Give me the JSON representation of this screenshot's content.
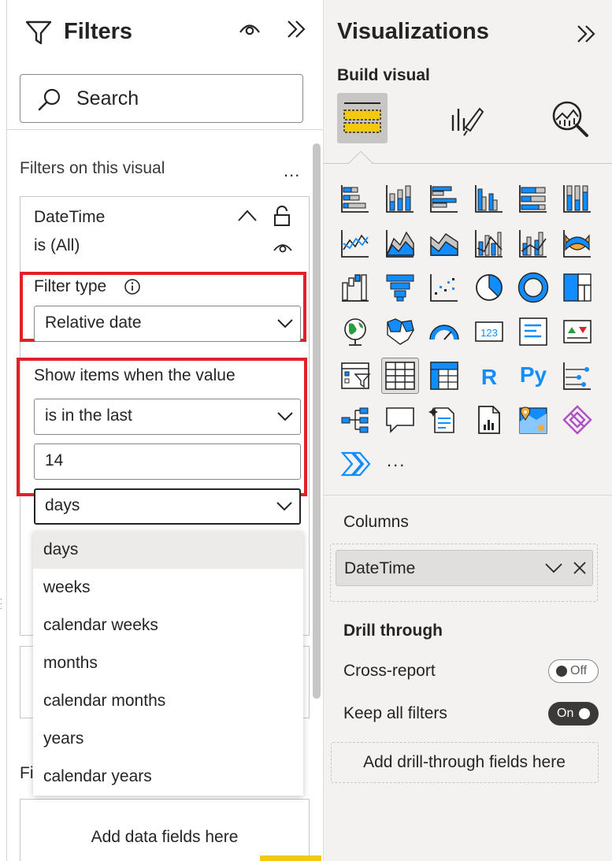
{
  "filters_pane": {
    "title": "Filters",
    "search_placeholder": "Search",
    "section_label": "Filters on this visual",
    "more": "...",
    "card": {
      "field_name": "DateTime",
      "summary": "is (All)",
      "filter_type_label": "Filter type",
      "filter_type_value": "Relative date",
      "show_items_label": "Show items when the value",
      "condition_value": "is in the last",
      "amount_value": "14",
      "unit_value": "days"
    },
    "unit_options": [
      "days",
      "weeks",
      "calendar weeks",
      "months",
      "calendar months",
      "years",
      "calendar years"
    ],
    "selected_option": "days",
    "next_section_label_partial": "Fi",
    "add_fields_label": "Add data fields here"
  },
  "viz_pane": {
    "title": "Visualizations",
    "build_label": "Build visual",
    "more": "...",
    "icons": [
      "stacked-bar-chart-icon",
      "stacked-column-chart-icon",
      "clustered-bar-chart-icon",
      "clustered-column-chart-icon",
      "100-percent-stacked-bar-chart-icon",
      "100-percent-stacked-column-chart-icon",
      "line-chart-icon",
      "area-chart-icon",
      "stacked-area-chart-icon",
      "line-and-stacked-column-chart-icon",
      "line-and-clustered-column-chart-icon",
      "ribbon-chart-icon",
      "waterfall-chart-icon",
      "funnel-chart-icon",
      "scatter-chart-icon",
      "pie-chart-icon",
      "donut-chart-icon",
      "treemap-icon",
      "map-icon",
      "filled-map-icon",
      "gauge-icon",
      "card-icon",
      "multi-row-card-icon",
      "kpi-icon",
      "slicer-icon",
      "table-icon",
      "matrix-icon",
      "r-script-visual-icon",
      "python-visual-icon",
      "key-influencers-icon",
      "decomposition-tree-icon",
      "qna-icon",
      "smart-narrative-icon",
      "paginated-report-icon",
      "azure-map-icon",
      "power-apps-icon",
      "power-automate-icon"
    ],
    "icon_texts": {
      "card": "123",
      "r": "R",
      "py": "Py"
    },
    "selected_icon": "table-icon",
    "columns_label": "Columns",
    "column_field": "DateTime",
    "drill_through_label": "Drill through",
    "cross_report_label": "Cross-report",
    "cross_report_state": "Off",
    "keep_filters_label": "Keep all filters",
    "keep_filters_state": "On",
    "add_drill_label": "Add drill-through fields here"
  },
  "colors": {
    "accent_blue": "#118dff",
    "highlight_red": "#e22027",
    "selected_yellow": "#f2c811",
    "pane_bg": "#f3f2f1"
  }
}
